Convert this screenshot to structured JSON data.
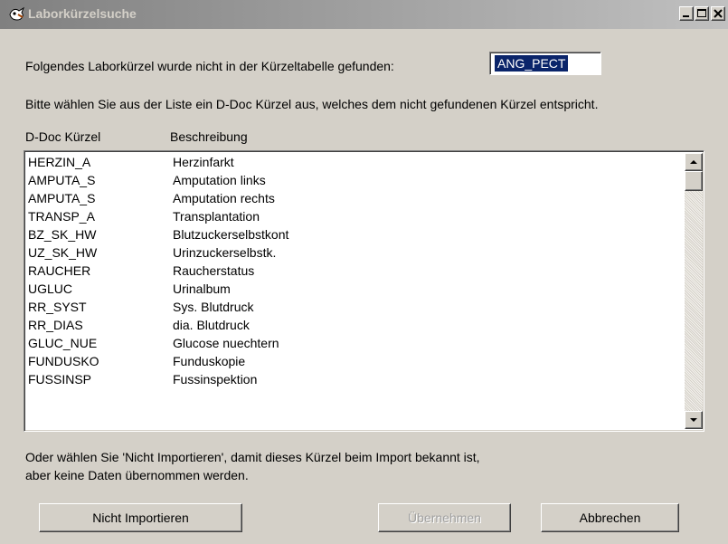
{
  "window": {
    "title": "Laborkürzelsuche",
    "icon": "lab-app-icon",
    "controls": [
      "minimize-icon",
      "maximize-icon",
      "close-icon"
    ]
  },
  "prompt": {
    "not_found_text": "Folgendes Laborkürzel wurde nicht in der Kürzeltabelle gefunden:",
    "code_value": "ANG_PECT",
    "instruction": "Bitte wählen Sie aus der Liste ein D-Doc Kürzel aus, welches dem nicht gefundenen Kürzel entspricht."
  },
  "list": {
    "columns": [
      "D-Doc Kürzel",
      "Beschreibung"
    ],
    "rows": [
      [
        "HERZIN_A",
        "Herzinfarkt"
      ],
      [
        "AMPUTA_S",
        "Amputation links"
      ],
      [
        "AMPUTA_S",
        "Amputation rechts"
      ],
      [
        "TRANSP_A",
        "Transplantation"
      ],
      [
        "BZ_SK_HW",
        "Blutzuckerselbstkont"
      ],
      [
        "UZ_SK_HW",
        "Urinzuckerselbstk."
      ],
      [
        "RAUCHER",
        "Raucherstatus"
      ],
      [
        "UGLUC",
        "Urinalbum"
      ],
      [
        "RR_SYST",
        "Sys. Blutdruck"
      ],
      [
        "RR_DIAS",
        "dia. Blutdruck"
      ],
      [
        "GLUC_NUE",
        "Glucose nuechtern"
      ],
      [
        "FUNDUSKO",
        "Funduskopie"
      ],
      [
        "FUSSINSP",
        "Fussinspektion"
      ]
    ]
  },
  "hint": {
    "line1": "Oder wählen Sie 'Nicht Importieren', damit dieses Kürzel beim Import bekannt ist,",
    "line2": "aber keine Daten übernommen werden."
  },
  "buttons": {
    "skip": "Nicht Importieren",
    "apply": "Übernehmen",
    "cancel": "Abbrechen"
  },
  "colors": {
    "dialog_bg": "#d4d0c8",
    "selection_bg": "#0a246a",
    "title_gradient_start": "#808080",
    "disabled_text": "#a0a0a0"
  }
}
